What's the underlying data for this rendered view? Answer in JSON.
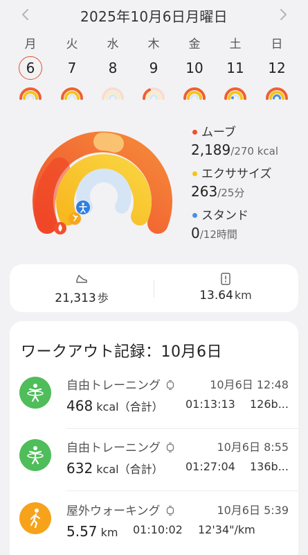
{
  "header": {
    "prev_icon": "chevron-left-icon",
    "next_icon": "chevron-right-icon",
    "title": "2025年10月6日月曜日"
  },
  "week": [
    {
      "weekday": "月",
      "date": "6",
      "selected": true
    },
    {
      "weekday": "火",
      "date": "7",
      "selected": false
    },
    {
      "weekday": "水",
      "date": "8",
      "selected": false
    },
    {
      "weekday": "木",
      "date": "9",
      "selected": false
    },
    {
      "weekday": "金",
      "date": "10",
      "selected": false
    },
    {
      "weekday": "土",
      "date": "11",
      "selected": false
    },
    {
      "weekday": "日",
      "date": "12",
      "selected": false
    }
  ],
  "activity": {
    "colors": {
      "move": "#f0502e",
      "exercise": "#f5c518",
      "stand": "#4a90e2"
    },
    "move": {
      "label": "ムーブ",
      "value": "2,189",
      "goal": "/270 kcal",
      "progress": 8.1
    },
    "exercise": {
      "label": "エクササイズ",
      "value": "263",
      "goal": "/25分",
      "progress": 10.5
    },
    "stand": {
      "label": "スタンド",
      "value": "0",
      "goal": "/12時間",
      "progress": 0
    }
  },
  "stats": {
    "steps": {
      "icon": "shoe-icon",
      "value": "21,313",
      "unit": "歩"
    },
    "distance": {
      "icon": "map-pin-icon",
      "value": "13.64",
      "unit": "km"
    }
  },
  "workouts": {
    "title": "ワークアウト記録：10月6日",
    "items": [
      {
        "icon": "free-training-icon",
        "name": "自由トレーニング",
        "time": "10月6日 12:48",
        "value": "468",
        "unit": "kcal（合計）",
        "duration": "01:13:13",
        "extra": "126b..."
      },
      {
        "icon": "free-training-icon",
        "name": "自由トレーニング",
        "time": "10月6日 8:55",
        "value": "632",
        "unit": "kcal（合計）",
        "duration": "01:27:04",
        "extra": "136b..."
      },
      {
        "icon": "walking-icon",
        "name": "屋外ウォーキング",
        "time": "10月6日 5:39",
        "value": "5.57",
        "unit": "km",
        "duration": "01:10:02",
        "extra": "12'34\"/km"
      }
    ]
  }
}
